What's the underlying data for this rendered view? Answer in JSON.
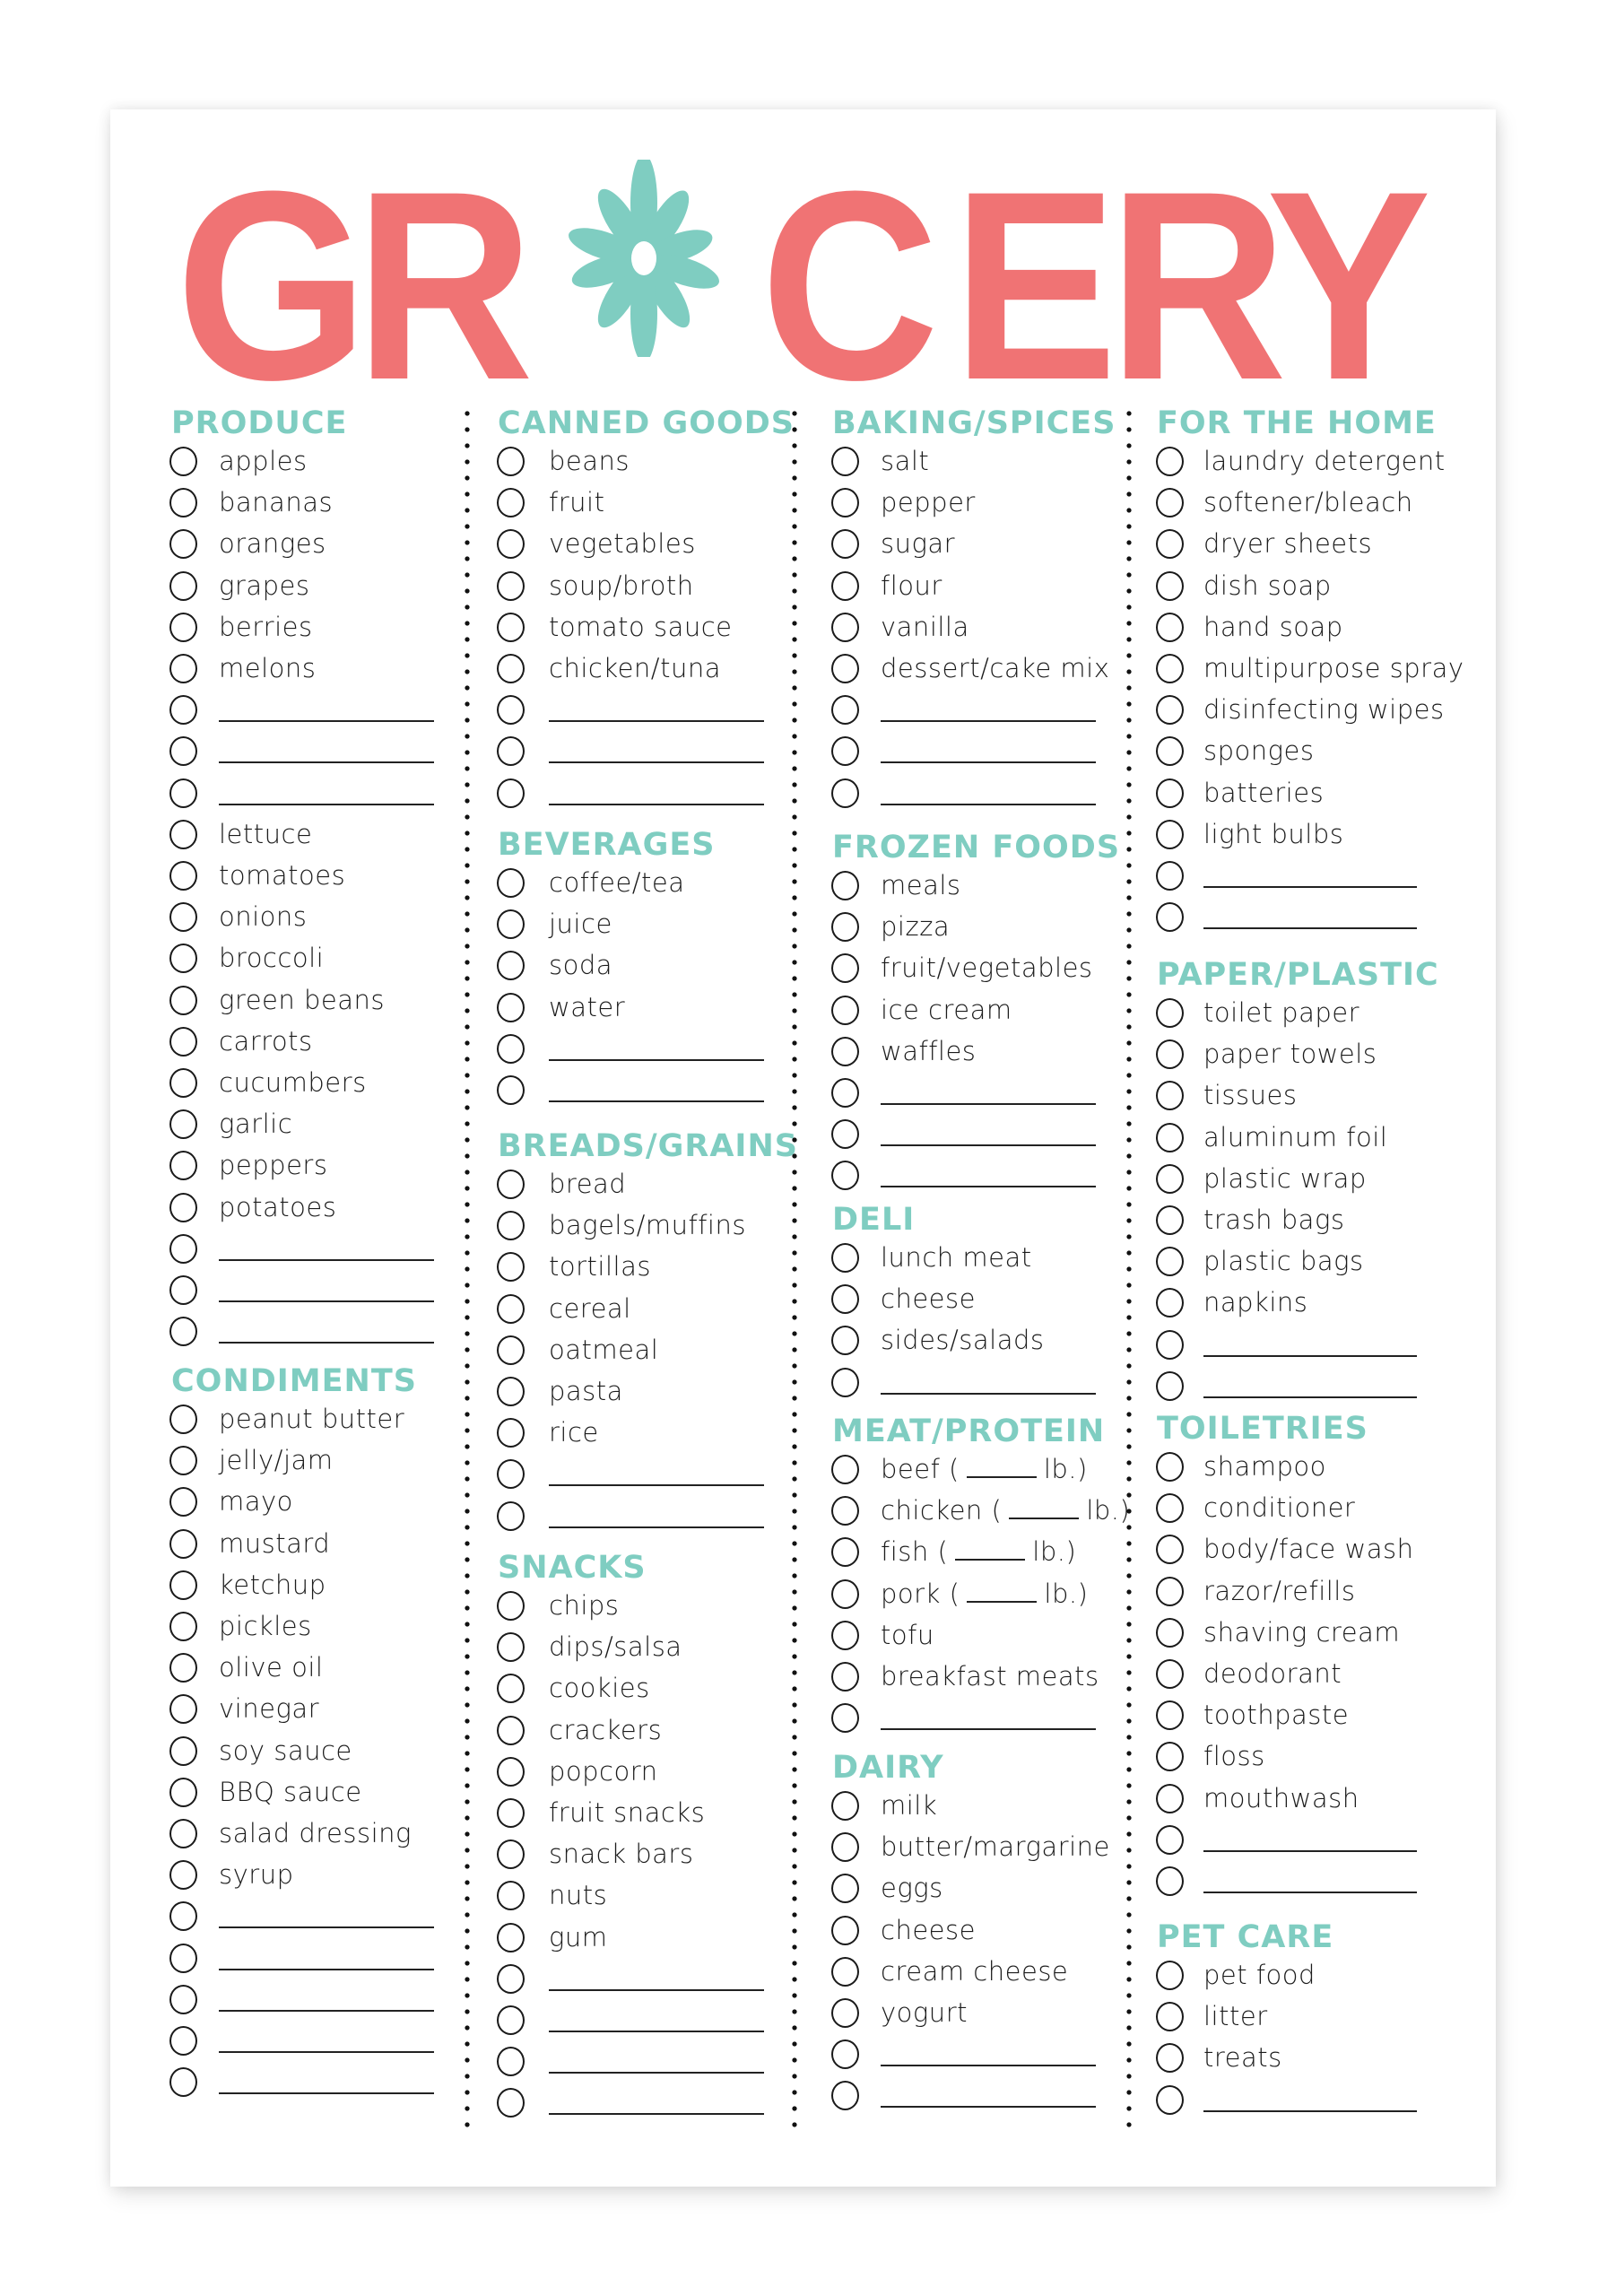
{
  "title": {
    "letters_before": [
      "G",
      "R"
    ],
    "letters_after": [
      "C",
      "E",
      "R",
      "Y"
    ],
    "full_text": "GROCERY",
    "o_replacement_icon": "flower-icon"
  },
  "colors": {
    "title": "#f07374",
    "headers_and_flower": "#7fcdc1",
    "text": "#1c1c1c"
  },
  "columns": [
    {
      "sections": [
        {
          "header": "PRODUCE",
          "items": [
            "apples",
            "bananas",
            "oranges",
            "grapes",
            "berries",
            "melons",
            "",
            "",
            "",
            "lettuce",
            "tomatoes",
            "onions",
            "broccoli",
            "green beans",
            "carrots",
            "cucumbers",
            "garlic",
            "peppers",
            "potatoes",
            "",
            "",
            ""
          ]
        },
        {
          "header": "CONDIMENTS",
          "items": [
            "peanut butter",
            "jelly/jam",
            "mayo",
            "mustard",
            "ketchup",
            "pickles",
            "olive oil",
            "vinegar",
            "soy sauce",
            "BBQ sauce",
            "salad dressing",
            "syrup",
            "",
            "",
            "",
            "",
            ""
          ]
        }
      ]
    },
    {
      "sections": [
        {
          "header": "CANNED GOODS",
          "items": [
            "beans",
            "fruit",
            "vegetables",
            "soup/broth",
            "tomato sauce",
            "chicken/tuna",
            "",
            "",
            ""
          ]
        },
        {
          "header": "BEVERAGES",
          "items": [
            "coffee/tea",
            "juice",
            "soda",
            "water",
            "",
            ""
          ]
        },
        {
          "header": "BREADS/GRAINS",
          "items": [
            "bread",
            "bagels/muffins",
            "tortillas",
            "cereal",
            "oatmeal",
            "pasta",
            "rice",
            "",
            ""
          ]
        },
        {
          "header": "SNACKS",
          "items": [
            "chips",
            "dips/salsa",
            "cookies",
            "crackers",
            "popcorn",
            "fruit snacks",
            "snack bars",
            "nuts",
            "gum",
            "",
            "",
            "",
            ""
          ]
        }
      ]
    },
    {
      "sections": [
        {
          "header": "BAKING/SPICES",
          "items": [
            "salt",
            "pepper",
            "sugar",
            "flour",
            "vanilla",
            "dessert/cake mix",
            "",
            "",
            ""
          ]
        },
        {
          "header": "FROZEN FOODS",
          "items": [
            "meals",
            "pizza",
            "fruit/vegetables",
            "ice cream",
            "waffles",
            "",
            "",
            ""
          ]
        },
        {
          "header": "DELI",
          "items": [
            "lunch meat",
            "cheese",
            "sides/salads",
            ""
          ]
        },
        {
          "header": "MEAT/PROTEIN",
          "items": [
            "beef ( _ lb.)",
            "chicken ( _ lb.)",
            "fish ( _ lb.)",
            "pork ( _ lb.)",
            "tofu",
            "breakfast meats",
            ""
          ]
        },
        {
          "header": "DAIRY",
          "items": [
            "milk",
            "butter/margarine",
            "eggs",
            "cheese",
            "cream cheese",
            "yogurt",
            "",
            ""
          ]
        }
      ]
    },
    {
      "sections": [
        {
          "header": "FOR THE HOME",
          "items": [
            "laundry detergent",
            "softener/bleach",
            "dryer sheets",
            "dish soap",
            "hand soap",
            "multipurpose spray",
            "disinfecting wipes",
            "sponges",
            "batteries",
            "light bulbs",
            "",
            ""
          ]
        },
        {
          "header": "PAPER/PLASTIC",
          "items": [
            "toilet paper",
            "paper towels",
            "tissues",
            "aluminum foil",
            "plastic wrap",
            "trash bags",
            "plastic bags",
            "napkins",
            "",
            ""
          ]
        },
        {
          "header": "TOILETRIES",
          "items": [
            "shampoo",
            "conditioner",
            "body/face wash",
            "razor/refills",
            "shaving cream",
            "deodorant",
            "toothpaste",
            "floss",
            "mouthwash",
            "",
            ""
          ]
        },
        {
          "header": "PET CARE",
          "items": [
            "pet food",
            "litter",
            "treats",
            ""
          ]
        }
      ]
    }
  ]
}
